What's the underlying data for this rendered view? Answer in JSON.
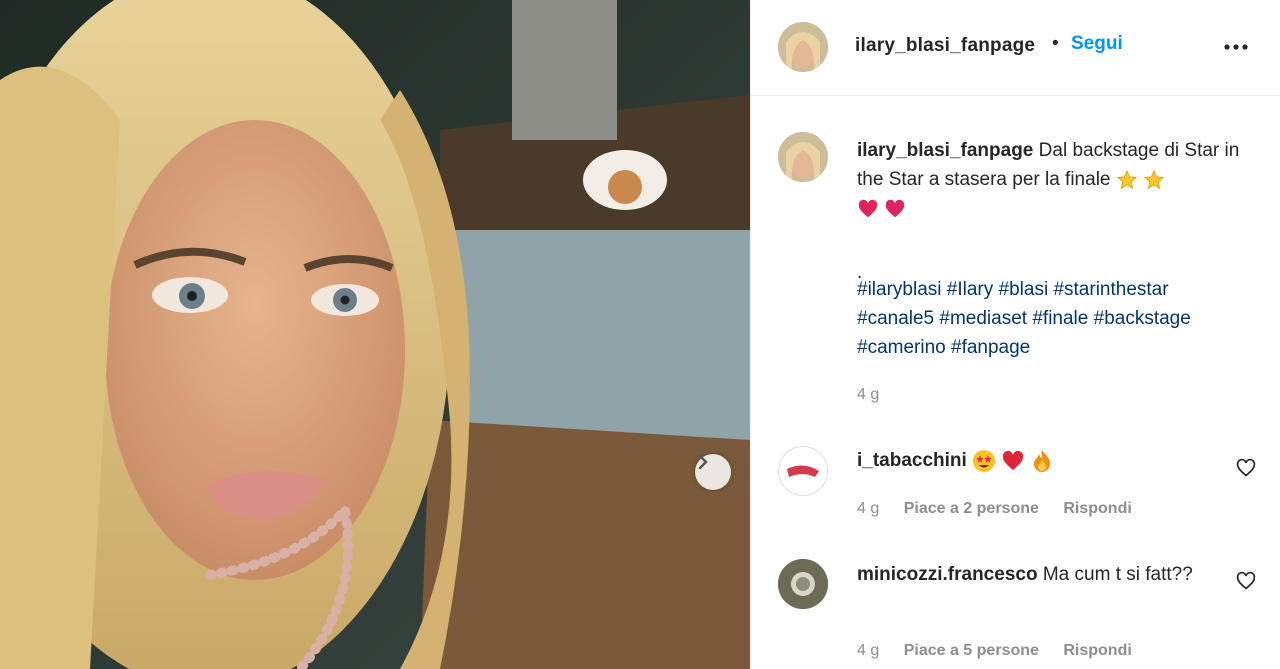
{
  "post": {
    "username": "ilary_blasi_fanpage",
    "separator": "•",
    "follow_label": "Segui",
    "more_icon": "more-horizontal-icon"
  },
  "caption": {
    "username": "ilary_blasi_fanpage",
    "text": "Dal backstage di Star in the Star a stasera per la finale",
    "emojis": [
      "star-emoji",
      "star-emoji",
      "heart-emoji",
      "heart-emoji"
    ],
    "period": ".",
    "hashtags": [
      "#ilaryblasi",
      "#Ilary",
      "#blasi",
      "#starinthestar",
      "#canale5",
      "#mediaset",
      "#finale",
      "#backstage",
      "#camerino",
      "#fanpage"
    ],
    "time": "4 g"
  },
  "comments": [
    {
      "username": "i_tabacchini",
      "text": "",
      "emojis": [
        "star-struck-emoji",
        "red-heart-emoji",
        "fire-emoji"
      ],
      "time": "4 g",
      "likes": "Piace a 2 persone",
      "reply": "Rispondi"
    },
    {
      "username": "minicozzi.francesco",
      "text": "Ma cum t si fatt??",
      "emojis": [],
      "time": "4 g",
      "likes": "Piace a 5 persone",
      "reply": "Rispondi"
    }
  ],
  "colors": {
    "link": "#0095f6",
    "hashtag": "#00376b",
    "muted": "#8e8e8e",
    "text": "#262626"
  }
}
